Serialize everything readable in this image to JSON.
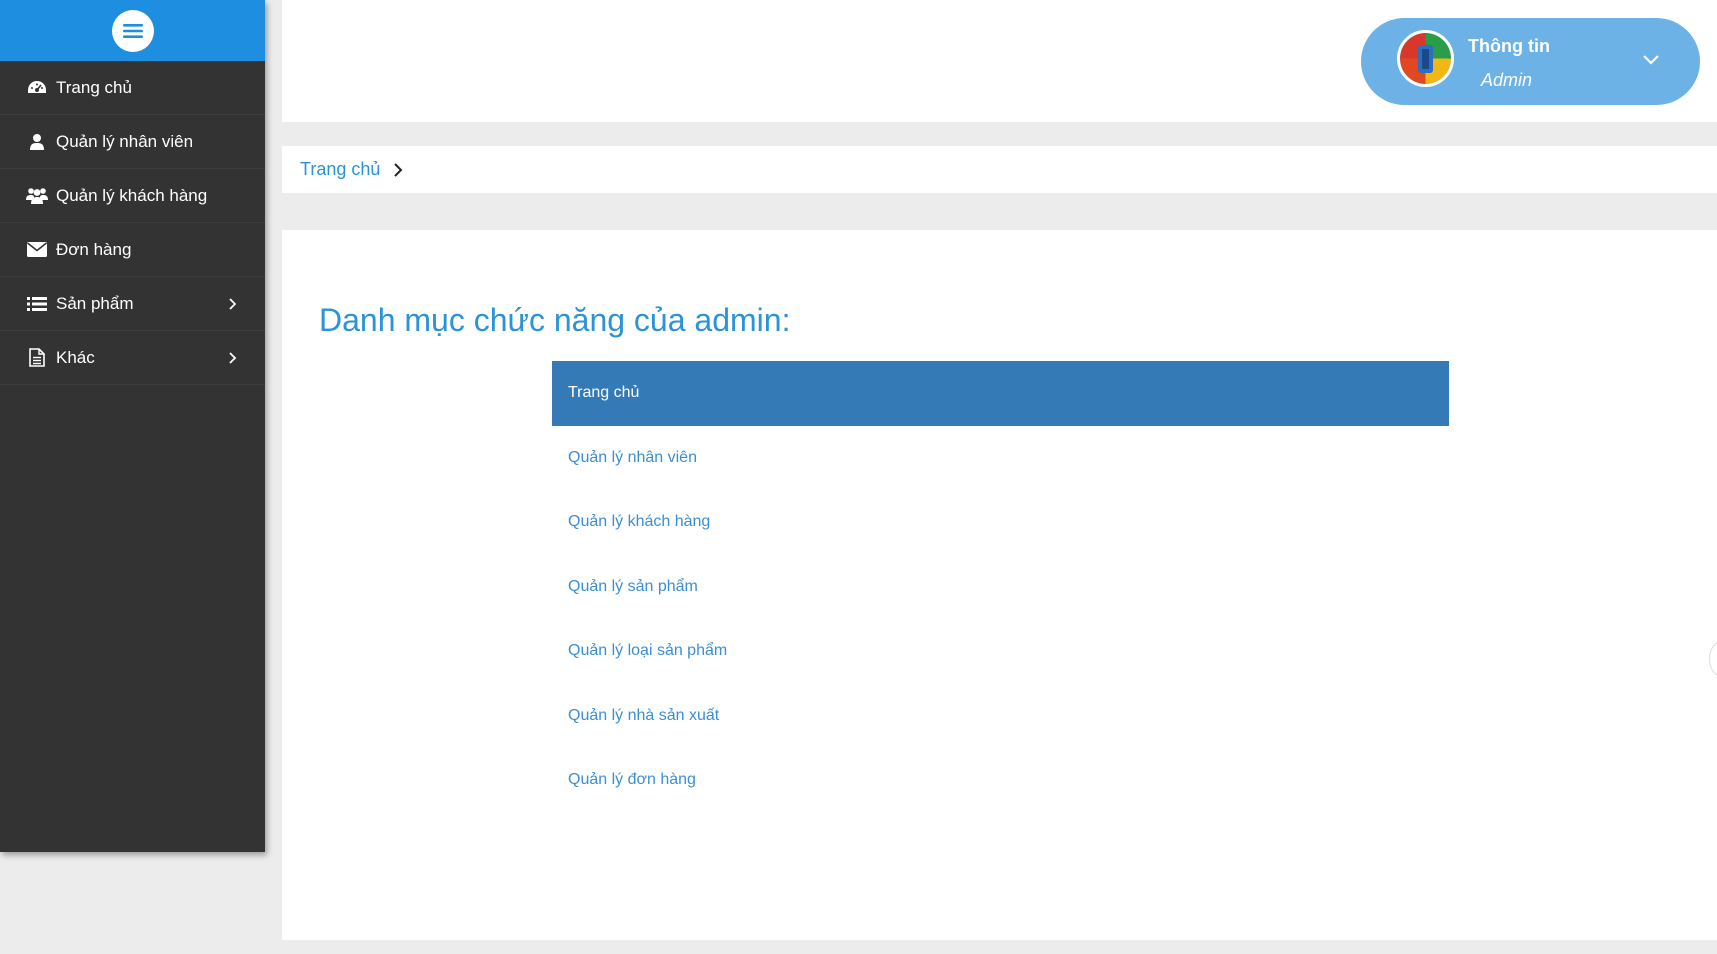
{
  "sidebar": {
    "items": [
      {
        "label": "Trang chủ",
        "icon": "dashboard-icon",
        "has_submenu": false
      },
      {
        "label": "Quản lý nhân viên",
        "icon": "user-icon",
        "has_submenu": false
      },
      {
        "label": "Quản lý khách hàng",
        "icon": "users-icon",
        "has_submenu": false
      },
      {
        "label": "Đơn hàng",
        "icon": "envelope-icon",
        "has_submenu": false
      },
      {
        "label": "Sản phẩm",
        "icon": "list-icon",
        "has_submenu": true
      },
      {
        "label": "Khác",
        "icon": "document-icon",
        "has_submenu": true
      }
    ]
  },
  "header": {
    "user": {
      "title": "Thông tin",
      "role": "Admin"
    }
  },
  "breadcrumb": {
    "items": [
      "Trang chủ"
    ]
  },
  "main": {
    "title": "Danh mục chức năng của admin:",
    "functions": [
      {
        "label": "Trang chủ",
        "active": true
      },
      {
        "label": "Quản lý nhân viên",
        "active": false
      },
      {
        "label": "Quản lý khách hàng",
        "active": false
      },
      {
        "label": "Quản lý sản phẩm",
        "active": false
      },
      {
        "label": "Quản lý loại sản phẩm",
        "active": false
      },
      {
        "label": "Quản lý nhà sản xuất",
        "active": false
      },
      {
        "label": "Quản lý đơn hàng",
        "active": false
      }
    ]
  },
  "colors": {
    "sidebar_bg": "#333333",
    "sidebar_head": "#1e8fe0",
    "accent": "#2b93d6",
    "active_row": "#337ab7",
    "user_pill": "#6cb2e6"
  }
}
